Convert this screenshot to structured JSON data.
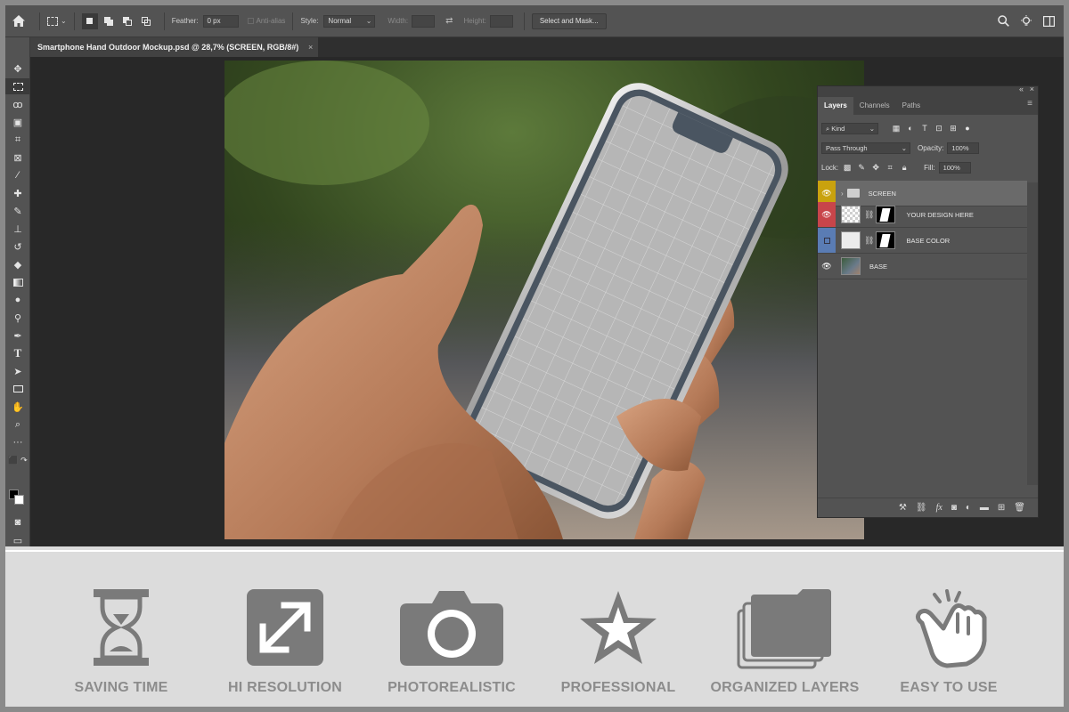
{
  "options_bar": {
    "feather_label": "Feather:",
    "feather_value": "0 px",
    "anti_alias_label": "Anti-alias",
    "style_label": "Style:",
    "style_value": "Normal",
    "width_label": "Width:",
    "height_label": "Height:",
    "select_and_mask_label": "Select and Mask..."
  },
  "document_tab": {
    "title": "Smartphone Hand Outdoor Mockup.psd @ 28,7% (SCREEN, RGB/8#)",
    "close_glyph": "×"
  },
  "layers_panel": {
    "tabs": [
      "Layers",
      "Channels",
      "Paths"
    ],
    "filter_kind": "Kind",
    "blend_mode": "Pass Through",
    "opacity_label": "Opacity:",
    "opacity_value": "100%",
    "lock_label": "Lock:",
    "fill_label": "Fill:",
    "fill_value": "100%",
    "layers": [
      {
        "name": "SCREEN",
        "type": "group",
        "color": "#c9a20e",
        "visible": true
      },
      {
        "name": "YOUR DESIGN HERE",
        "type": "smart-object",
        "color": "#c8454a",
        "visible": true
      },
      {
        "name": "BASE COLOR",
        "type": "fill",
        "color": "#5a7cb4",
        "visible": false
      },
      {
        "name": "BASE",
        "type": "image",
        "color": "",
        "visible": true
      }
    ]
  },
  "features": [
    {
      "label": "SAVING TIME",
      "icon": "hourglass-icon"
    },
    {
      "label": "HI RESOLUTION",
      "icon": "expand-arrows-icon"
    },
    {
      "label": "PHOTOREALISTIC",
      "icon": "camera-icon"
    },
    {
      "label": "PROFESSIONAL",
      "icon": "star-icon"
    },
    {
      "label": "ORGANIZED LAYERS",
      "icon": "stacked-folders-icon"
    },
    {
      "label": "EASY TO USE",
      "icon": "pointing-hand-icon"
    }
  ],
  "colors": {
    "feature_icon": "#7a7a7a",
    "feature_label": "#8c8c8c",
    "panel_bg": "#535353",
    "app_bg": "#282828"
  }
}
